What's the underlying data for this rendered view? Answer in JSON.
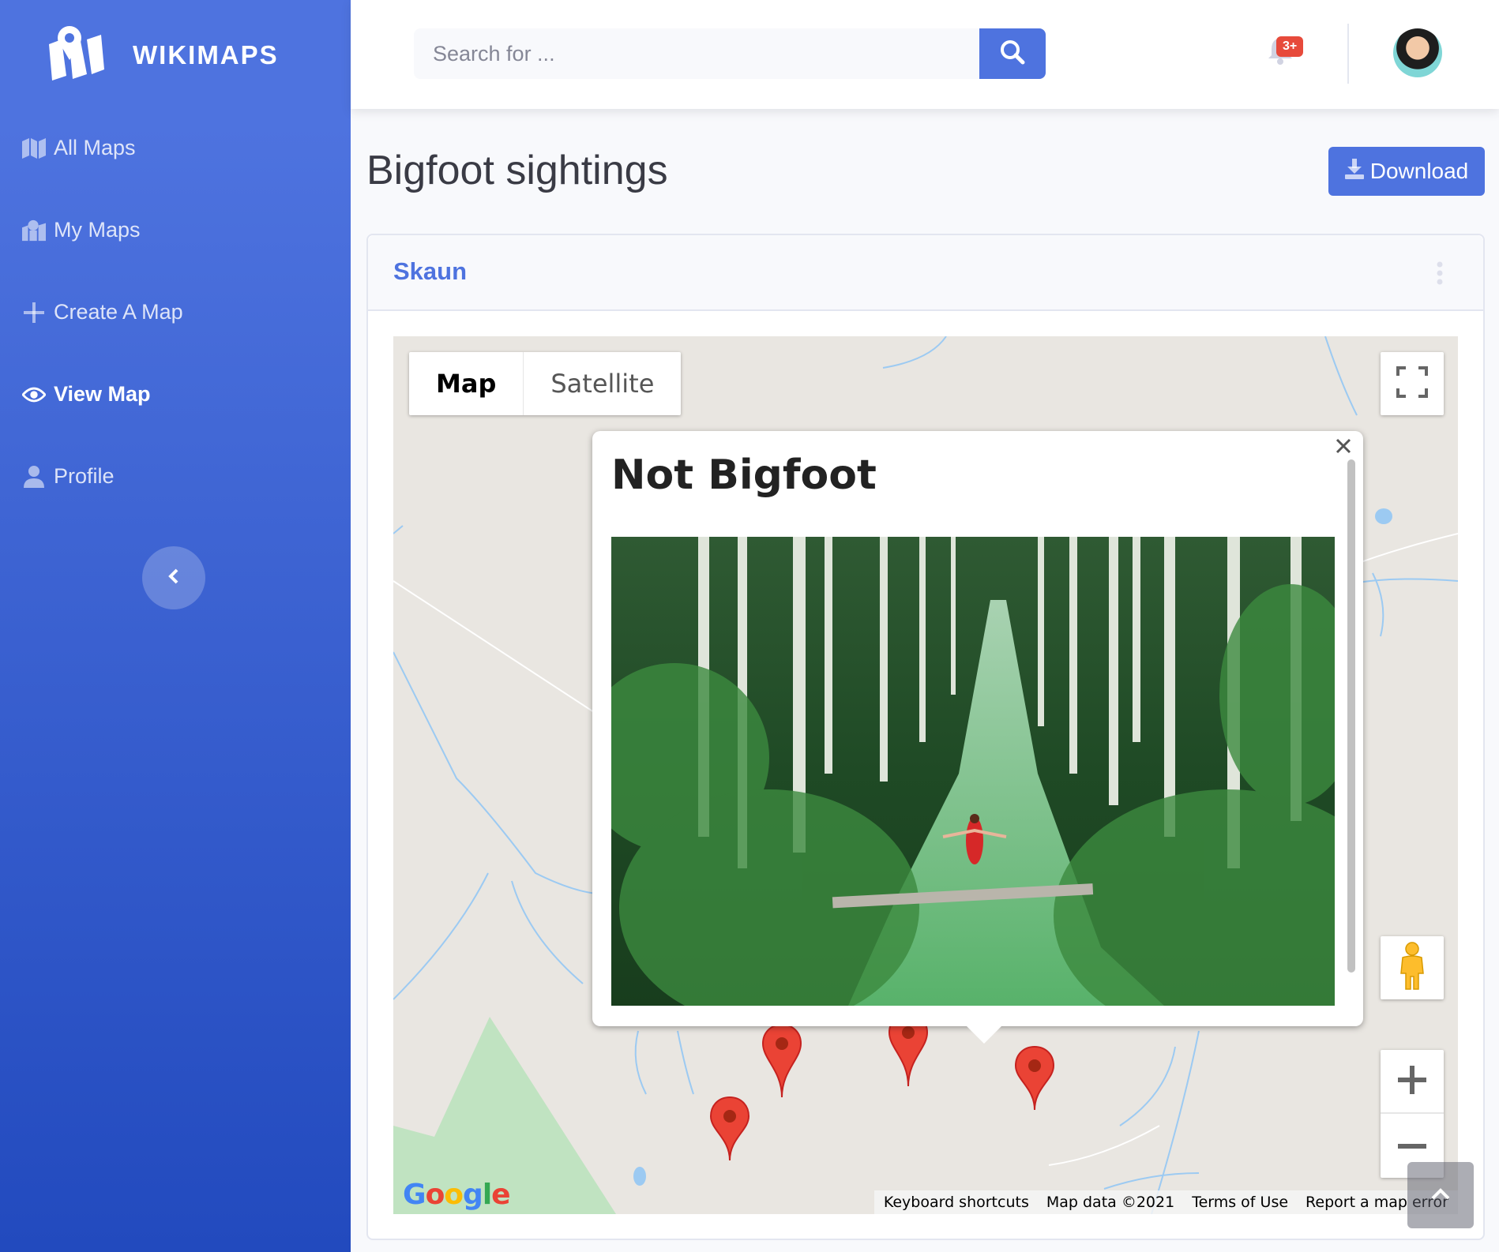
{
  "brand": {
    "name": "WIKIMAPS"
  },
  "sidebar": {
    "items": [
      {
        "label": "All Maps",
        "icon": "map-icon"
      },
      {
        "label": "My Maps",
        "icon": "map-marked-icon"
      },
      {
        "label": "Create A Map",
        "icon": "plus-icon"
      },
      {
        "label": "View Map",
        "icon": "eye-icon",
        "active": true
      },
      {
        "label": "Profile",
        "icon": "user-icon"
      }
    ]
  },
  "topbar": {
    "search_placeholder": "Search for ...",
    "alerts_badge": "3+"
  },
  "page": {
    "title": "Bigfoot sightings",
    "download_label": "Download"
  },
  "card": {
    "title": "Skaun"
  },
  "map": {
    "type_map": "Map",
    "type_satellite": "Satellite",
    "infowindow": {
      "title": "Not Bigfoot"
    },
    "footer": {
      "keyboard": "Keyboard shortcuts",
      "data": "Map data ©2021",
      "terms": "Terms of Use",
      "report": "Report a map error"
    },
    "google": "Google"
  },
  "colors": {
    "primary": "#4e73df",
    "danger": "#e74a3b",
    "marker": "#ea4335"
  }
}
